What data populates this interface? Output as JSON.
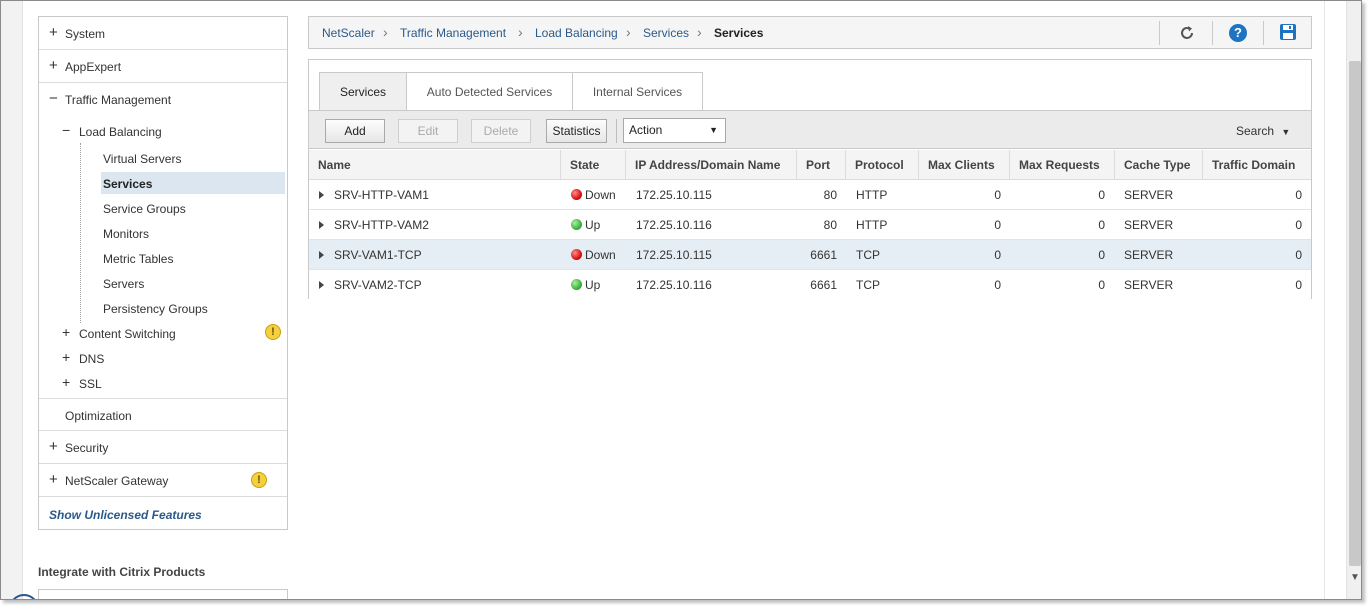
{
  "nav": {
    "system": "System",
    "appexpert": "AppExpert",
    "traffic_management": "Traffic Management",
    "load_balancing": "Load Balancing",
    "lb_items": [
      "Virtual Servers",
      "Services",
      "Service Groups",
      "Monitors",
      "Metric Tables",
      "Servers",
      "Persistency Groups"
    ],
    "content_switching": "Content Switching",
    "dns": "DNS",
    "ssl": "SSL",
    "optimization": "Optimization",
    "security": "Security",
    "netscaler_gateway": "NetScaler Gateway",
    "show_unlicensed": "Show Unlicensed Features"
  },
  "integrate_title": "Integrate with Citrix Products",
  "breadcrumb": [
    "NetScaler",
    "Traffic Management",
    "Load Balancing",
    "Services",
    "Services"
  ],
  "tabs": [
    "Services",
    "Auto Detected Services",
    "Internal Services"
  ],
  "toolbar": {
    "add": "Add",
    "edit": "Edit",
    "delete": "Delete",
    "statistics": "Statistics",
    "action": "Action",
    "search": "Search"
  },
  "columns": [
    "Name",
    "State",
    "IP Address/Domain Name",
    "Port",
    "Protocol",
    "Max Clients",
    "Max Requests",
    "Cache Type",
    "Traffic Domain"
  ],
  "rows": [
    {
      "name": "SRV-HTTP-VAM1",
      "state": "Down",
      "ip": "172.25.10.115",
      "port": "80",
      "protocol": "HTTP",
      "max_clients": "0",
      "max_requests": "0",
      "cache_type": "SERVER",
      "traffic_domain": "0"
    },
    {
      "name": "SRV-HTTP-VAM2",
      "state": "Up",
      "ip": "172.25.10.116",
      "port": "80",
      "protocol": "HTTP",
      "max_clients": "0",
      "max_requests": "0",
      "cache_type": "SERVER",
      "traffic_domain": "0"
    },
    {
      "name": "SRV-VAM1-TCP",
      "state": "Down",
      "ip": "172.25.10.115",
      "port": "6661",
      "protocol": "TCP",
      "max_clients": "0",
      "max_requests": "0",
      "cache_type": "SERVER",
      "traffic_domain": "0"
    },
    {
      "name": "SRV-VAM2-TCP",
      "state": "Up",
      "ip": "172.25.10.116",
      "port": "6661",
      "protocol": "TCP",
      "max_clients": "0",
      "max_requests": "0",
      "cache_type": "SERVER",
      "traffic_domain": "0"
    }
  ],
  "colors": {
    "link": "#2b5a8a",
    "selected": "#dbe6f1",
    "down": "#d40000",
    "up": "#2fa82f",
    "warning": "#f4d03f"
  }
}
